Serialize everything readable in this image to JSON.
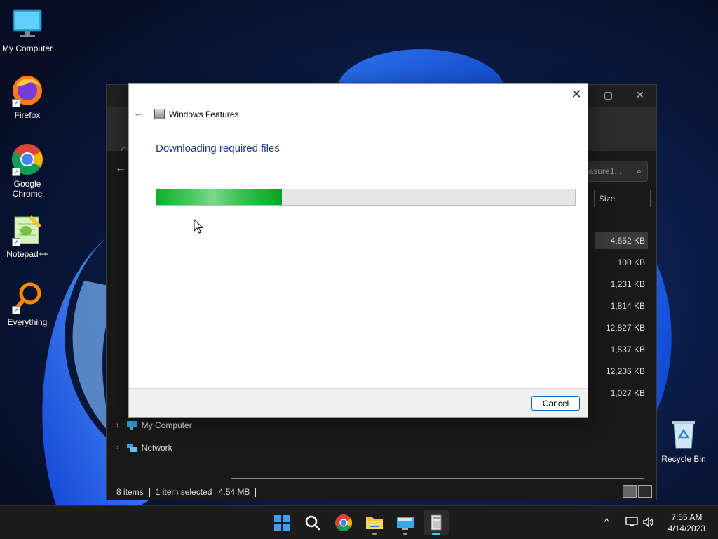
{
  "desktop": {
    "icons": [
      {
        "label": "My Computer"
      },
      {
        "label": "Firefox"
      },
      {
        "label": "Google Chrome"
      },
      {
        "label": "Notepad++"
      },
      {
        "label": "Everything"
      },
      {
        "label": "Recycle Bin"
      }
    ]
  },
  "explorer": {
    "search_text": "easure1...",
    "column_size": "Size",
    "sizes": [
      "4,652 KB",
      "100 KB",
      "1,231 KB",
      "1,814 KB",
      "12,827 KB",
      "1,537 KB",
      "12,236 KB",
      "1,027 KB"
    ],
    "nav": [
      {
        "label": "My Computer"
      },
      {
        "label": "Network"
      }
    ],
    "status": {
      "items": "8 items",
      "selected": "1 item selected",
      "size": "4.54 MB"
    }
  },
  "dialog": {
    "title": "Windows Features",
    "heading": "Downloading required files",
    "progress_fraction": 0.3,
    "cancel_label": "Cancel",
    "close_symbol": "✕"
  },
  "taskbar": {
    "apps": [
      "windows-start-icon",
      "search-icon",
      "chrome-icon",
      "file-explorer-icon",
      "remote-desktop-icon",
      "windows-features-icon"
    ],
    "time": "7:55 AM",
    "date": "4/14/2023"
  },
  "colors": {
    "progress_green": "#06a323",
    "heading_blue": "#1b3b7c",
    "accent": "#0067c0"
  }
}
